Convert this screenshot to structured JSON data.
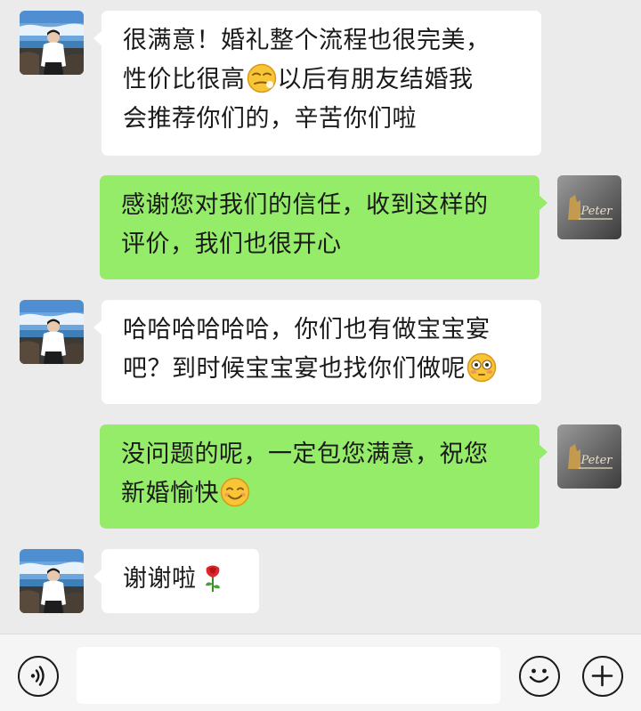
{
  "messages": [
    {
      "sender": "customer",
      "lines": [
        "很满意！婚礼整个流程也很完美，",
        "性价比很高",
        "以后有朋友结婚我",
        "会推荐你们的，辛苦你们啦"
      ],
      "emoji": "smirk-emoji"
    },
    {
      "sender": "studio",
      "lines": [
        "感谢您对我们的信任，收到这样的",
        "评价，我们也很开心"
      ]
    },
    {
      "sender": "customer",
      "lines": [
        "哈哈哈哈哈哈，你们也有做宝宝宴",
        "吧？到时候宝宝宴也找你们做呢"
      ],
      "emoji": "flushed-emoji"
    },
    {
      "sender": "studio",
      "lines": [
        "没问题的呢，一定包您满意，祝您",
        "新婚愉快"
      ],
      "emoji": "smile-emoji"
    },
    {
      "sender": "customer",
      "lines": [
        "谢谢啦"
      ],
      "emoji": "rose-emoji"
    }
  ],
  "studio_avatar_text": "Peter",
  "input": {
    "value": "",
    "placeholder": ""
  },
  "icons": {
    "voice": "voice-icon",
    "emoji": "emoji-icon",
    "add": "add-icon"
  },
  "colors": {
    "background": "#ebebeb",
    "outgoing_bubble": "#95ec69",
    "incoming_bubble": "#ffffff",
    "input_bar": "#f5f5f5"
  }
}
